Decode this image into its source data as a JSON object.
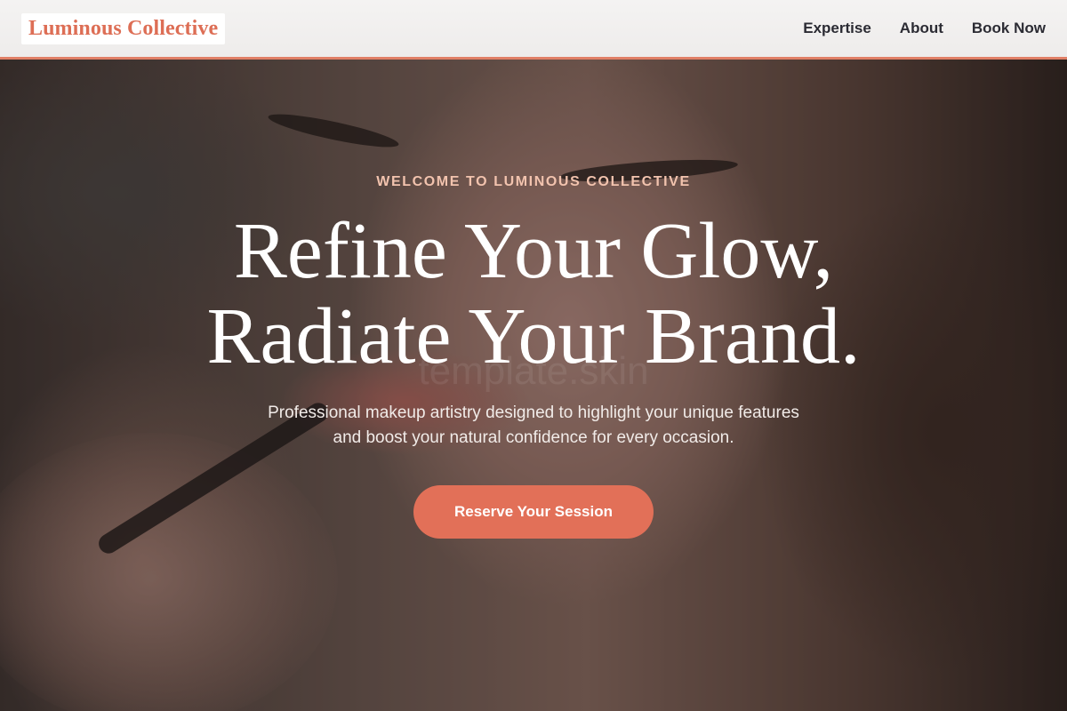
{
  "header": {
    "logo": "Luminous Collective",
    "nav": [
      "Expertise",
      "About",
      "Book Now"
    ]
  },
  "hero": {
    "eyebrow": "WELCOME TO LUMINOUS COLLECTIVE",
    "headline_line1": "Refine Your Glow,",
    "headline_line2": "Radiate Your Brand.",
    "subtext_line1": "Professional makeup artistry designed to highlight your unique features",
    "subtext_line2": "and boost your natural confidence for every occasion.",
    "cta": "Reserve Your Session",
    "watermark": "template.skin"
  },
  "colors": {
    "accent": "#e27058",
    "logo": "#dd6e55",
    "eyebrow": "#f2c3ae",
    "nav_text": "#2b2b33"
  }
}
